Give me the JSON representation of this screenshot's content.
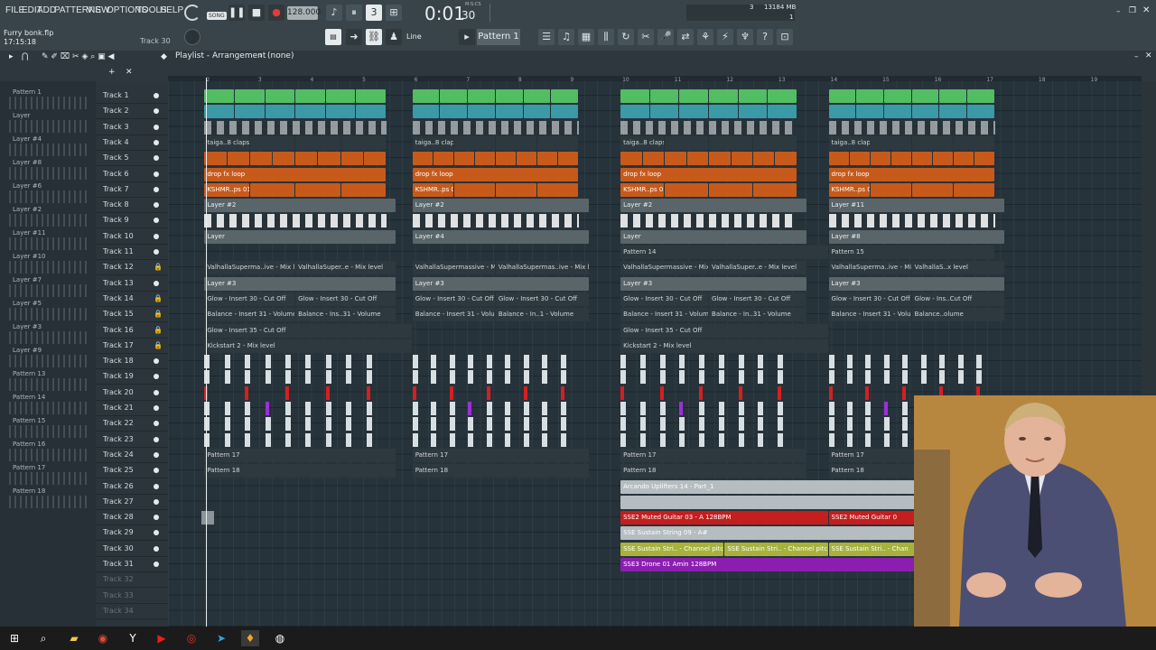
{
  "menu": [
    "FILE",
    "EDIT",
    "ADD",
    "PATTERNS",
    "VIEW",
    "OPTIONS",
    "TOOLS",
    "HELP"
  ],
  "transport": {
    "song_label": "SONG",
    "tempo": "128.000",
    "time": "0:01",
    "time_sub": "30",
    "time_unit": "M:S:CS",
    "cpu_val": "3",
    "mem": "13184 MB",
    "voices": "1"
  },
  "project": {
    "file": "Furry bonk.flp",
    "time": "17:15:18",
    "hint_track": "Track 30"
  },
  "toolbar": {
    "snap": "Line",
    "pattern": "Pattern 1"
  },
  "playlist": {
    "title": "Playlist - Arrangement",
    "sep": "›",
    "pattern_sel": "(none)"
  },
  "ruler": [
    "2",
    "3",
    "4",
    "5",
    "6",
    "7",
    "8",
    "9",
    "10",
    "11",
    "12",
    "13",
    "14",
    "15",
    "16",
    "17",
    "18",
    "19"
  ],
  "browser": [
    "Pattern 1",
    "Layer",
    "Layer #4",
    "Layer #8",
    "Layer #6",
    "Layer #2",
    "Layer #11",
    "Layer #10",
    "Layer #7",
    "Layer #5",
    "Layer #3",
    "Layer #9",
    "Pattern 13",
    "Pattern 14",
    "Pattern 15",
    "Pattern 16",
    "Pattern 17",
    "Pattern 18"
  ],
  "tracks": [
    "Track 1",
    "Track 2",
    "Track 3",
    "Track 4",
    "Track 5",
    "Track 6",
    "Track 7",
    "Track 8",
    "Track 9",
    "Track 10",
    "Track 11",
    "Track 12",
    "Track 13",
    "Track 14",
    "Track 15",
    "Track 16",
    "Track 17",
    "Track 18",
    "Track 19",
    "Track 20",
    "Track 21",
    "Track 22",
    "Track 23",
    "Track 24",
    "Track 25",
    "Track 26",
    "Track 27",
    "Track 28",
    "Track 29",
    "Track 30",
    "Track 31",
    "Track 32",
    "Track 33",
    "Track 34"
  ],
  "locked_tracks": [
    11,
    13,
    14,
    15,
    16
  ],
  "clips": {
    "t4": "taiga..8 claps",
    "t6": "drop fx loop",
    "t7": "KSHMR..ps 01",
    "t8": [
      "Layer #2",
      "Layer #2",
      "Layer #2",
      "Layer #11"
    ],
    "t10": [
      "Layer",
      "Layer #4",
      "Layer",
      "Layer #8"
    ],
    "t11": [
      "Pattern 14",
      "Pattern 15"
    ],
    "t12": [
      "ValhallaSuperma..ive - Mix level",
      "ValhallaSuper..e - Mix level",
      "ValhallaSupermassive - Mix level",
      "ValhallaSupermas..ive - Mix level",
      "ValhallaSupermassive - Mix level",
      "ValhallaSuper..e - Mix level",
      "ValhallaSuperma..ive - Mix level",
      "ValhallaS..x level"
    ],
    "t13": [
      "Layer #3",
      "Layer #3",
      "Layer #3",
      "Layer #3"
    ],
    "t14": [
      "Glow - Insert 30 - Cut Off",
      "Glow - Insert 30 - Cut Off",
      "Glow - Insert 30 - Cut Off",
      "Glow - Insert 30 - Cut Off",
      "Glow - Insert 30 - Cut Off",
      "Glow - Insert 30 - Cut Off",
      "Glow - Insert 30 - Cut Off",
      "Glow - Ins..Cut Off"
    ],
    "t15": [
      "Balance - Insert 31 - Volume",
      "Balance - Ins..31 - Volume",
      "Balance - Insert 31 - Volume",
      "Balance - In..1 - Volume",
      "Balance - Insert 31 - Volume",
      "Balance - In..31 - Volume",
      "Balance - Insert 31 - Volume",
      "Balance..olume"
    ],
    "t16": [
      "Glow - Insert 35 - Cut Off",
      "Glow - Insert 35 - Cut Off"
    ],
    "t17": [
      "Kickstart 2 - Mix level",
      "Kickstart 2 - Mix level"
    ],
    "t24": [
      "Pattern 17",
      "Pattern 17",
      "Pattern 17",
      "Pattern 17"
    ],
    "t25": [
      "Pattern 18",
      "Pattern 18",
      "Pattern 18",
      "Pattern 18"
    ],
    "t26": "Arcando Uplifters 14 - Part_1",
    "t28": [
      "SSE2 Muted Guitar 03 - A 128BPM",
      "SSE2 Muted Guitar 0"
    ],
    "t29": "SSE Sustain String 09 - A#",
    "t30": [
      "SSE Sustain Stri.. - Channel pitch",
      "SSE Sustain Stri.. - Channel pitch",
      "SSE Sustain Stri.. - Chan"
    ],
    "t31": "SSE3 Drone 01 Amin 128BPM"
  },
  "colors": {
    "green": "#52bd62",
    "teal": "#3a9aa8",
    "orange": "#c75a1b",
    "red": "#c51e1e",
    "purple": "#8b1eb0",
    "yellow": "#c6bf2a"
  }
}
